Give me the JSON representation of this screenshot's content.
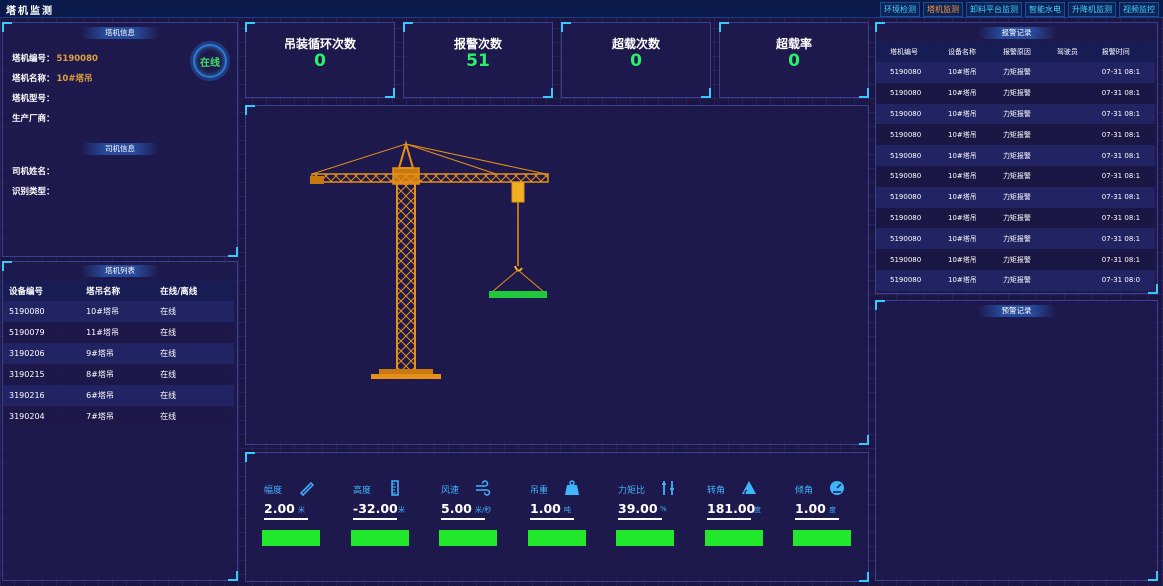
{
  "app": {
    "title": "塔机监测"
  },
  "nav": {
    "tabs": [
      {
        "label": "环境检测",
        "active": false
      },
      {
        "label": "塔机监测",
        "active": true
      },
      {
        "label": "卸料平台监测",
        "active": false
      },
      {
        "label": "智能水电",
        "active": false
      },
      {
        "label": "升降机监测",
        "active": false
      },
      {
        "label": "视频监控",
        "active": false
      }
    ]
  },
  "crane_info": {
    "section_title": "塔机信息",
    "status_badge": "在线",
    "fields": [
      {
        "label": "塔机编号：",
        "value": "5190080"
      },
      {
        "label": "塔机名称：",
        "value": "10#塔吊"
      },
      {
        "label": "塔机型号：",
        "value": ""
      },
      {
        "label": "生产厂商：",
        "value": ""
      }
    ]
  },
  "driver_info": {
    "section_title": "司机信息",
    "fields": [
      {
        "label": "司机姓名：",
        "value": ""
      },
      {
        "label": "识别类型：",
        "value": ""
      }
    ]
  },
  "crane_list": {
    "section_title": "塔机列表",
    "headers": [
      "设备编号",
      "塔吊名称",
      "在线/离线"
    ],
    "rows": [
      [
        "5190080",
        "10#塔吊",
        "在线"
      ],
      [
        "5190079",
        "11#塔吊",
        "在线"
      ],
      [
        "3190206",
        "9#塔吊",
        "在线"
      ],
      [
        "3190215",
        "8#塔吊",
        "在线"
      ],
      [
        "3190216",
        "6#塔吊",
        "在线"
      ],
      [
        "3190204",
        "7#塔吊",
        "在线"
      ]
    ]
  },
  "stats": [
    {
      "label": "吊装循环次数",
      "value": "0"
    },
    {
      "label": "报警次数",
      "value": "51"
    },
    {
      "label": "超载次数",
      "value": "0"
    },
    {
      "label": "超载率",
      "value": "0"
    }
  ],
  "sensors": [
    {
      "label": "幅度",
      "value": "2.00",
      "unit": "米",
      "icon": "ruler-icon"
    },
    {
      "label": "高度",
      "value": "-32.00",
      "unit": "米",
      "icon": "height-ruler-icon"
    },
    {
      "label": "风速",
      "value": "5.00",
      "unit": "米/秒",
      "icon": "wind-icon"
    },
    {
      "label": "吊重",
      "value": "1.00",
      "unit": "吨",
      "icon": "weight-icon"
    },
    {
      "label": "力矩比",
      "value": "39.00",
      "unit": "%",
      "icon": "tools-icon"
    },
    {
      "label": "转角",
      "value": "181.00",
      "unit": "度",
      "icon": "angle-icon"
    },
    {
      "label": "倾角",
      "value": "1.00",
      "unit": "度",
      "icon": "tilt-gauge-icon"
    }
  ],
  "alarm_records": {
    "section_title": "报警记录",
    "headers": [
      "塔机编号",
      "设备名称",
      "报警原因",
      "驾驶员",
      "报警时间"
    ],
    "rows": [
      [
        "5190080",
        "10#塔吊",
        "力矩报警",
        "",
        "07-31 08:1"
      ],
      [
        "5190080",
        "10#塔吊",
        "力矩报警",
        "",
        "07-31 08:1"
      ],
      [
        "5190080",
        "10#塔吊",
        "力矩报警",
        "",
        "07-31 08:1"
      ],
      [
        "5190080",
        "10#塔吊",
        "力矩报警",
        "",
        "07-31 08:1"
      ],
      [
        "5190080",
        "10#塔吊",
        "力矩报警",
        "",
        "07-31 08:1"
      ],
      [
        "5190080",
        "10#塔吊",
        "力矩报警",
        "",
        "07-31 08:1"
      ],
      [
        "5190080",
        "10#塔吊",
        "力矩报警",
        "",
        "07-31 08:1"
      ],
      [
        "5190080",
        "10#塔吊",
        "力矩报警",
        "",
        "07-31 08:1"
      ],
      [
        "5190080",
        "10#塔吊",
        "力矩报警",
        "",
        "07-31 08:1"
      ],
      [
        "5190080",
        "10#塔吊",
        "力矩报警",
        "",
        "07-31 08:1"
      ],
      [
        "5190080",
        "10#塔吊",
        "力矩报警",
        "",
        "07-31 08:0"
      ]
    ]
  },
  "warning_records": {
    "section_title": "预警记录"
  },
  "colors": {
    "background": "#1c1645",
    "accent_blue": "#39c8ff",
    "stat_green": "#2cf06a",
    "bar_green": "#22e82c",
    "crane_orange": "#e6901a",
    "info_value": "#e0a040"
  }
}
